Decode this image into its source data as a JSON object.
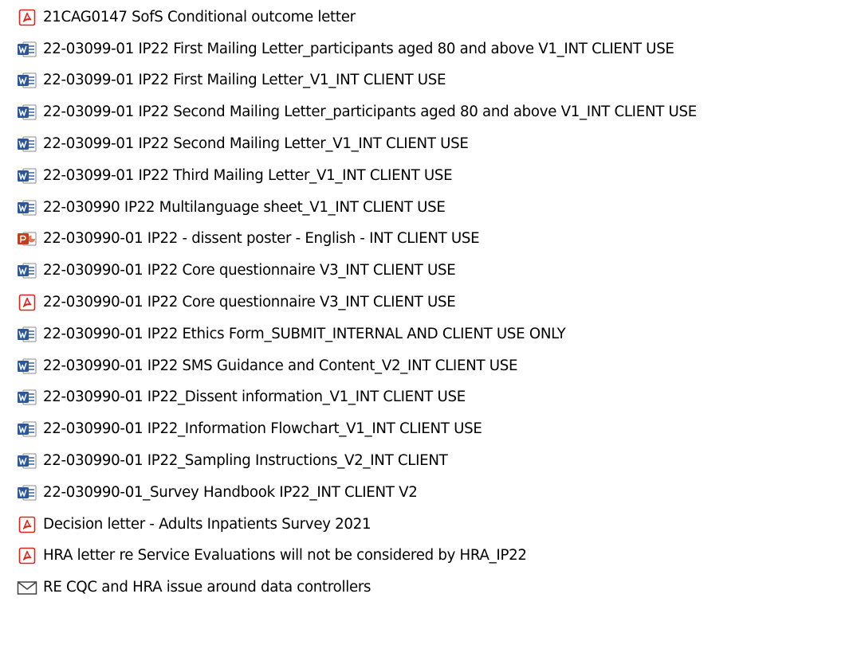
{
  "colors": {
    "pdf": "#d9261c",
    "word": "#2b579a",
    "powerpoint": "#c43e1c",
    "mail": "#404040"
  },
  "files": [
    {
      "name": "21CAG0147 SofS Conditional outcome letter",
      "type": "pdf",
      "icon": "pdf-icon"
    },
    {
      "name": "22-03099-01 IP22 First Mailing Letter_participants aged 80 and above V1_INT CLIENT USE",
      "type": "word",
      "icon": "word-doc-icon"
    },
    {
      "name": "22-03099-01 IP22 First Mailing Letter_V1_INT CLIENT USE",
      "type": "word",
      "icon": "word-doc-icon"
    },
    {
      "name": "22-03099-01 IP22 Second Mailing Letter_participants aged 80 and above V1_INT CLIENT USE",
      "type": "word",
      "icon": "word-doc-icon"
    },
    {
      "name": "22-03099-01 IP22 Second Mailing Letter_V1_INT CLIENT USE",
      "type": "word",
      "icon": "word-doc-icon"
    },
    {
      "name": "22-03099-01 IP22 Third Mailing Letter_V1_INT CLIENT USE",
      "type": "word",
      "icon": "word-doc-icon"
    },
    {
      "name": "22-030990 IP22 Multilanguage sheet_V1_INT CLIENT USE",
      "type": "word",
      "icon": "word-doc-icon"
    },
    {
      "name": "22-030990-01 IP22 - dissent poster - English - INT CLIENT USE",
      "type": "powerpoint",
      "icon": "powerpoint-icon"
    },
    {
      "name": "22-030990-01 IP22 Core questionnaire V3_INT CLIENT USE",
      "type": "word",
      "icon": "word-doc-icon"
    },
    {
      "name": "22-030990-01 IP22 Core questionnaire V3_INT CLIENT USE",
      "type": "pdf",
      "icon": "pdf-icon"
    },
    {
      "name": "22-030990-01 IP22 Ethics Form_SUBMIT_INTERNAL AND CLIENT USE ONLY",
      "type": "word",
      "icon": "word-doc-icon"
    },
    {
      "name": "22-030990-01 IP22 SMS Guidance and Content_V2_INT CLIENT USE",
      "type": "word",
      "icon": "word-doc-icon"
    },
    {
      "name": "22-030990-01 IP22_Dissent information_V1_INT CLIENT USE",
      "type": "word",
      "icon": "word-doc-icon"
    },
    {
      "name": "22-030990-01 IP22_Information Flowchart_V1_INT CLIENT USE",
      "type": "word",
      "icon": "word-doc-icon"
    },
    {
      "name": "22-030990-01 IP22_Sampling Instructions_V2_INT CLIENT",
      "type": "word",
      "icon": "word-doc-icon"
    },
    {
      "name": "22-030990-01_Survey Handbook IP22_INT CLIENT V2",
      "type": "word",
      "icon": "word-doc-icon"
    },
    {
      "name": "Decision letter - Adults Inpatients Survey 2021",
      "type": "pdf",
      "icon": "pdf-icon"
    },
    {
      "name": "HRA letter re Service Evaluations will not be considered by HRA_IP22",
      "type": "pdf",
      "icon": "pdf-icon"
    },
    {
      "name": "RE CQC and HRA issue around data controllers",
      "type": "mail",
      "icon": "mail-icon"
    }
  ]
}
